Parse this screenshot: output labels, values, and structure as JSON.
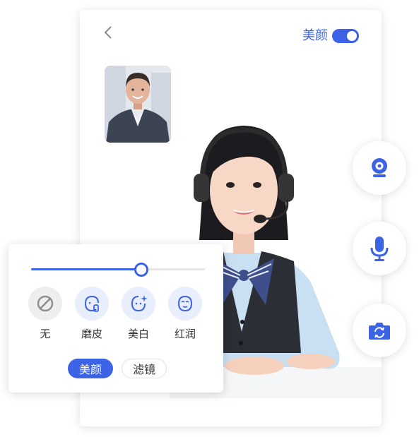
{
  "header": {
    "beauty_label": "美颜",
    "beauty_enabled": true
  },
  "beauty_panel": {
    "level": 0.63,
    "options": [
      {
        "label": "无",
        "icon": "none-icon"
      },
      {
        "label": "磨皮",
        "icon": "smooth-skin-icon"
      },
      {
        "label": "美白",
        "icon": "whitening-icon"
      },
      {
        "label": "红润",
        "icon": "rosy-icon"
      }
    ],
    "tabs": [
      {
        "label": "美颜",
        "active": true
      },
      {
        "label": "滤镜",
        "active": false
      }
    ]
  },
  "controls": [
    "camera-icon",
    "microphone-icon",
    "switch-camera-icon"
  ],
  "colors": {
    "accent": "#3c63e6",
    "option_bg": "#e8eefc",
    "none_bg": "#eeeeee"
  }
}
